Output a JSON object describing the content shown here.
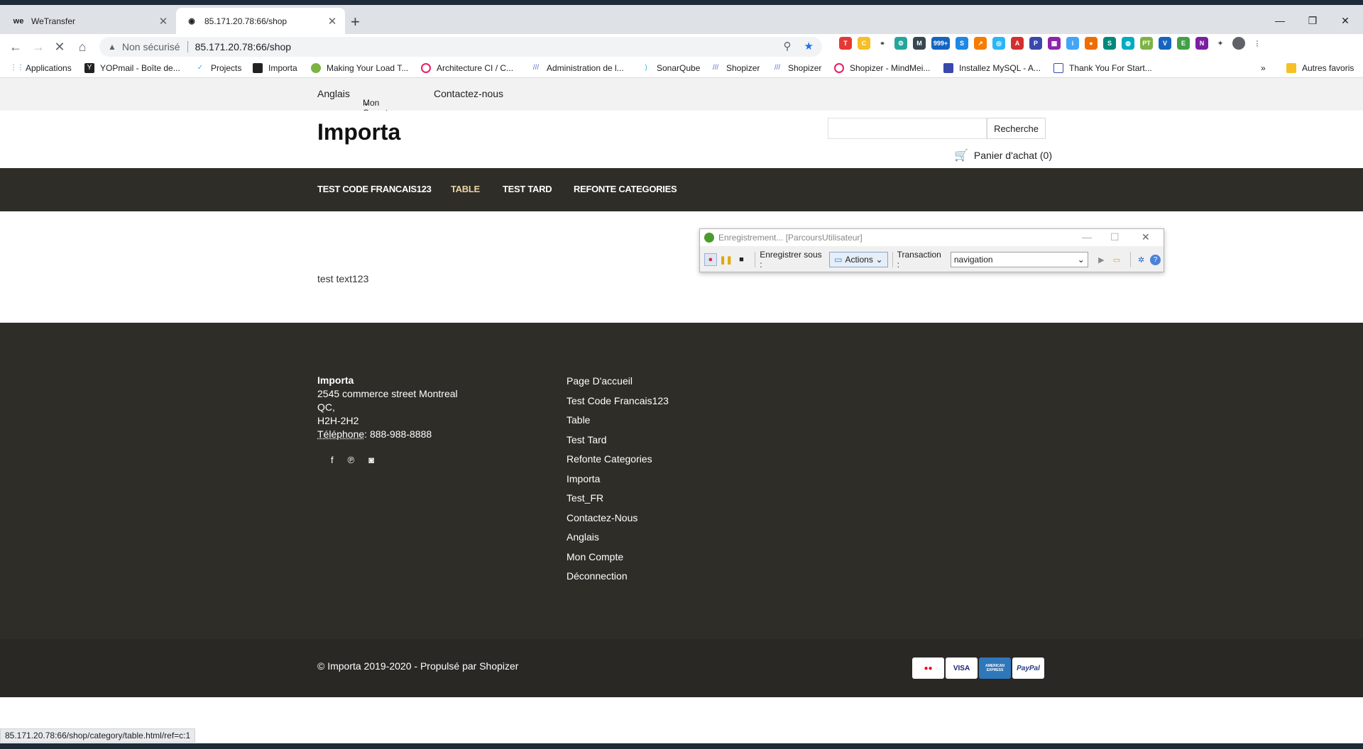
{
  "browser": {
    "tabs": [
      {
        "label": "WeTransfer",
        "icon": "wetransfer-icon"
      },
      {
        "label": "85.171.20.78:66/shop",
        "icon": "page-icon"
      }
    ],
    "address": {
      "security": "Non sécurisé",
      "url": "85.171.20.78:66/shop"
    },
    "bookmarks": [
      "Applications",
      "YOPmail - Boîte de...",
      "Projects",
      "Importa",
      "Making Your Load T...",
      "Architecture CI / C...",
      "Administration de l...",
      "SonarQube",
      "Shopizer",
      "Shopizer",
      "Shopizer - MindMei...",
      "Installez MySQL - A...",
      "Thank You For Start..."
    ],
    "other_bookmarks": "Autres favoris",
    "ext_badge": "999+",
    "status_url": "85.171.20.78:66/shop/category/table.html/ref=c:1"
  },
  "topnav": {
    "lang": "Anglais",
    "account": "Mon Compte",
    "contact": "Contactez-nous"
  },
  "header": {
    "logo": "Importa",
    "search_button": "Recherche",
    "cart": "Panier d'achat (0)"
  },
  "menu": [
    "TEST CODE FRANCAIS123",
    "TABLE",
    "TEST TARD",
    "REFONTE CATEGORIES"
  ],
  "content": {
    "text": "test text123"
  },
  "recorder": {
    "title": "Enregistrement... [ParcoursUtilisateur]",
    "save_label": "Enregistrer sous :",
    "save_value": "Actions",
    "transaction_label": "Transaction :",
    "transaction_value": "navigation"
  },
  "footer": {
    "company": "Importa",
    "address1": "2545 commerce street Montreal",
    "address2": "QC,",
    "address3": "H2H-2H2",
    "phone_label": "Téléphone",
    "phone": ": 888-988-8888",
    "links": [
      "Page D'accueil",
      "Test Code Francais123",
      "Table",
      "Test Tard",
      "Refonte Categories",
      "Importa",
      "Test_FR",
      "Contactez-Nous",
      "Anglais",
      "Mon Compte",
      "Déconnection"
    ],
    "copyright": "© Importa 2019-2020 - Propulsé par Shopizer",
    "payments": [
      "MasterCard",
      "VISA",
      "AMERICAN EXPRESS",
      "PayPal"
    ]
  },
  "colors": {
    "nav_bg": "#2f2d28",
    "active_menu": "#e8d5a3",
    "topnav_bg": "#f2f2f2"
  }
}
